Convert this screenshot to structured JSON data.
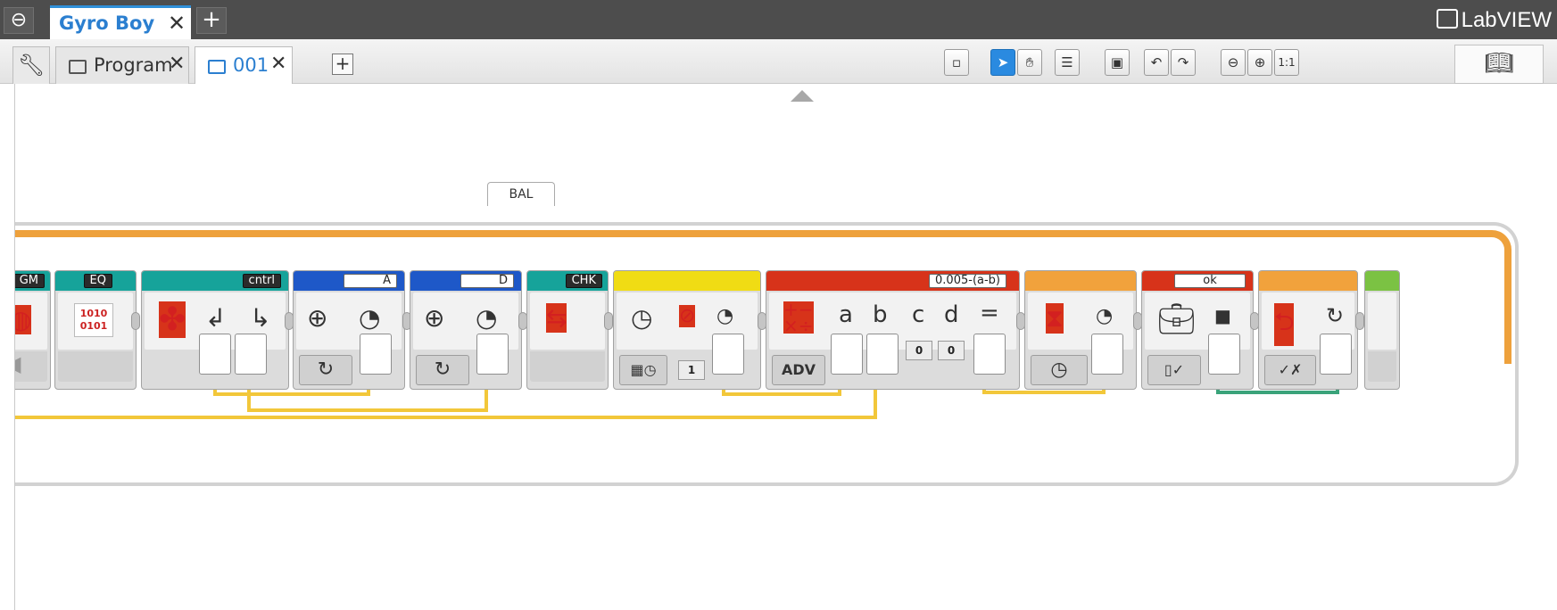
{
  "app": {
    "project_tab": "Gyro Boy",
    "brand": "LabVIEW"
  },
  "tabs": [
    {
      "label": "Program"
    },
    {
      "label": "001"
    }
  ],
  "toolbar": {
    "zoom_reset": "1:1"
  },
  "loop": {
    "label": "BAL"
  },
  "blocks": [
    {
      "header": "GM",
      "color": "#16a39a"
    },
    {
      "header": "EQ",
      "color": "#16a39a",
      "icon_text": "1010\n0101"
    },
    {
      "header": "cntrl",
      "color": "#16a39a"
    },
    {
      "header": "A",
      "color": "#1e58c8"
    },
    {
      "header": "D",
      "color": "#1e58c8"
    },
    {
      "header": "CHK",
      "color": "#16a39a"
    },
    {
      "header": "",
      "color": "#f0dc14",
      "input_value": "1"
    },
    {
      "header": "0.005-(a-b)",
      "color": "#d7331a",
      "mode": "ADV",
      "params": [
        "a",
        "b",
        "c",
        "d",
        "="
      ],
      "c_value": "0",
      "d_value": "0"
    },
    {
      "header": "",
      "color": "#f1a23c"
    },
    {
      "header": "ok",
      "color": "#d7331a"
    },
    {
      "header": "",
      "color": "#f1a23c"
    },
    {
      "header": "",
      "color": "#7bc243"
    }
  ],
  "colors": {
    "accent": "#2a8ae0",
    "loop_wire": "#eea13c",
    "data_wire_yellow": "#f2c73a",
    "data_wire_green": "#3aa37a"
  }
}
